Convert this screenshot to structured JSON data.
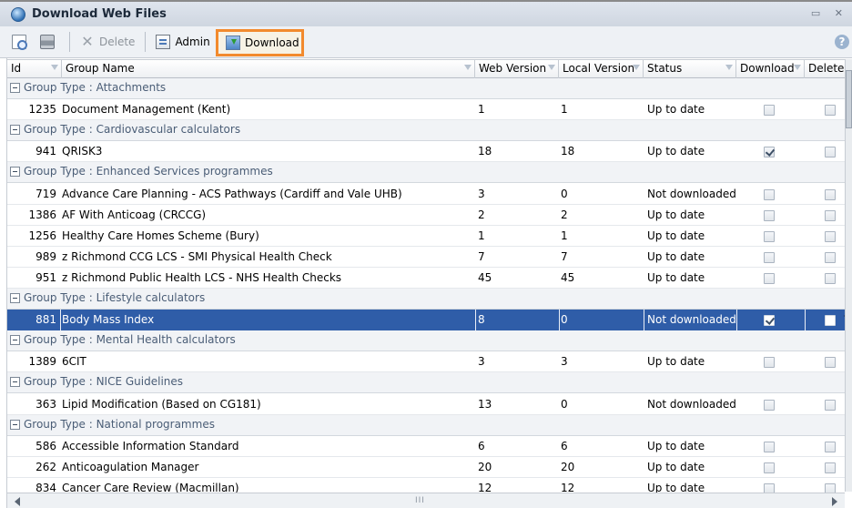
{
  "window": {
    "title": "Download Web Files",
    "controls": "▭ ✕"
  },
  "toolbar": {
    "delete_label": "Delete",
    "admin_label": "Admin",
    "download_label": "Download",
    "help": "?"
  },
  "columns": {
    "id": "Id",
    "name": "Group Name",
    "web": "Web Version",
    "local": "Local Version",
    "status": "Status",
    "download": "Download",
    "delete": "Delete"
  },
  "rows": [
    {
      "type": "group",
      "label": "Group Type : Attachments"
    },
    {
      "type": "item",
      "id": "1235",
      "name": "Document Management (Kent)",
      "web": "1",
      "local": "1",
      "status": "Up to date",
      "download": false,
      "delete": false
    },
    {
      "type": "group",
      "label": "Group Type : Cardiovascular calculators"
    },
    {
      "type": "item",
      "id": "941",
      "name": "QRISK3",
      "web": "18",
      "local": "18",
      "status": "Up to date",
      "download": true,
      "delete": false
    },
    {
      "type": "group",
      "label": "Group Type : Enhanced Services programmes"
    },
    {
      "type": "item",
      "id": "719",
      "name": "Advance Care Planning - ACS Pathways (Cardiff and Vale UHB)",
      "web": "3",
      "local": "0",
      "status": "Not downloaded",
      "download": false,
      "delete": false
    },
    {
      "type": "item",
      "id": "1386",
      "name": "AF With Anticoag  (CRCCG)",
      "web": "2",
      "local": "2",
      "status": "Up to date",
      "download": false,
      "delete": false
    },
    {
      "type": "item",
      "id": "1256",
      "name": "Healthy Care Homes Scheme (Bury)",
      "web": "1",
      "local": "1",
      "status": "Up to date",
      "download": false,
      "delete": false
    },
    {
      "type": "item",
      "id": "989",
      "name": "z Richmond CCG LCS - SMI Physical Health Check",
      "web": "7",
      "local": "7",
      "status": "Up to date",
      "download": false,
      "delete": false
    },
    {
      "type": "item",
      "id": "951",
      "name": "z Richmond Public Health LCS - NHS Health Checks",
      "web": "45",
      "local": "45",
      "status": "Up to date",
      "download": false,
      "delete": false
    },
    {
      "type": "group",
      "label": "Group Type : Lifestyle calculators"
    },
    {
      "type": "item",
      "id": "881",
      "name": "Body Mass Index",
      "web": "8",
      "local": "0",
      "status": "Not downloaded",
      "download": true,
      "delete": false,
      "selected": true
    },
    {
      "type": "group",
      "label": "Group Type : Mental Health calculators"
    },
    {
      "type": "item",
      "id": "1389",
      "name": "6CIT",
      "web": "3",
      "local": "3",
      "status": "Up to date",
      "download": false,
      "delete": false
    },
    {
      "type": "group",
      "label": "Group Type : NICE Guidelines"
    },
    {
      "type": "item",
      "id": "363",
      "name": "Lipid Modification (Based on CG181)",
      "web": "13",
      "local": "0",
      "status": "Not downloaded",
      "download": false,
      "delete": false
    },
    {
      "type": "group",
      "label": "Group Type : National programmes"
    },
    {
      "type": "item",
      "id": "586",
      "name": "Accessible Information Standard",
      "web": "6",
      "local": "6",
      "status": "Up to date",
      "download": false,
      "delete": false
    },
    {
      "type": "item",
      "id": "262",
      "name": "Anticoagulation Manager",
      "web": "20",
      "local": "20",
      "status": "Up to date",
      "download": false,
      "delete": false
    },
    {
      "type": "item",
      "id": "834",
      "name": "Cancer Care Review (Macmillan)",
      "web": "12",
      "local": "12",
      "status": "Up to date",
      "download": false,
      "delete": false
    }
  ],
  "scrollbar": {
    "grip": "III"
  },
  "colors": {
    "selection": "#2f5da8",
    "highlight": "#f28a2e"
  }
}
